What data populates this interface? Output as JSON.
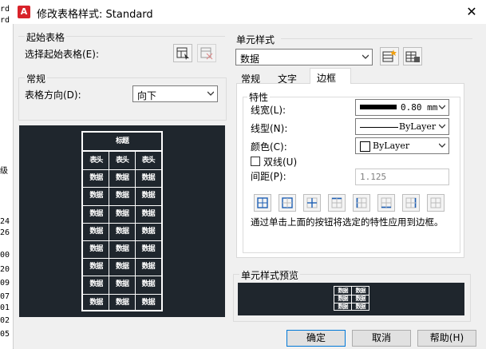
{
  "window": {
    "title": "修改表格样式: Standard",
    "close_glyph": "✕",
    "app_icon_letter": "A"
  },
  "background_strip": {
    "top_fragments": [
      "rd",
      "rd"
    ],
    "mid_fragment": "级",
    "row_fragments": [
      "24",
      "26",
      "00",
      "20",
      "09",
      "07",
      "01",
      "02",
      "05"
    ]
  },
  "start_table": {
    "heading": "起始表格",
    "select_label": "选择起始表格(E):"
  },
  "general": {
    "heading": "常规",
    "direction_label": "表格方向(D):",
    "direction_value": "向下"
  },
  "preview": {
    "title_glyph": "标题",
    "header_glyph": "表头",
    "data_glyph": "数据"
  },
  "cell_style": {
    "heading": "单元样式",
    "selected": "数据"
  },
  "tabs": [
    {
      "label": "常规"
    },
    {
      "label": "文字"
    },
    {
      "label": "边框"
    }
  ],
  "properties": {
    "heading": "特性",
    "lineweight_label": "线宽(L):",
    "lineweight_value": "0.80 mm",
    "linetype_label": "线型(N):",
    "linetype_value": "ByLayer",
    "color_label": "颜色(C):",
    "color_value": "ByLayer",
    "double_line_label": "双线(U)",
    "double_line_checked": false,
    "spacing_label": "间距(P):",
    "spacing_value": "1.125",
    "hint": "通过单击上面的按钮将选定的特性应用到边框。"
  },
  "border_buttons": [
    "all-borders-icon",
    "outside-borders-icon",
    "inside-borders-icon",
    "top-border-icon",
    "left-border-icon",
    "bottom-border-icon",
    "right-border-icon",
    "no-border-icon"
  ],
  "cell_preview": {
    "heading": "单元样式预览"
  },
  "buttons": {
    "ok": "确定",
    "cancel": "取消",
    "help": "帮助(H)"
  }
}
